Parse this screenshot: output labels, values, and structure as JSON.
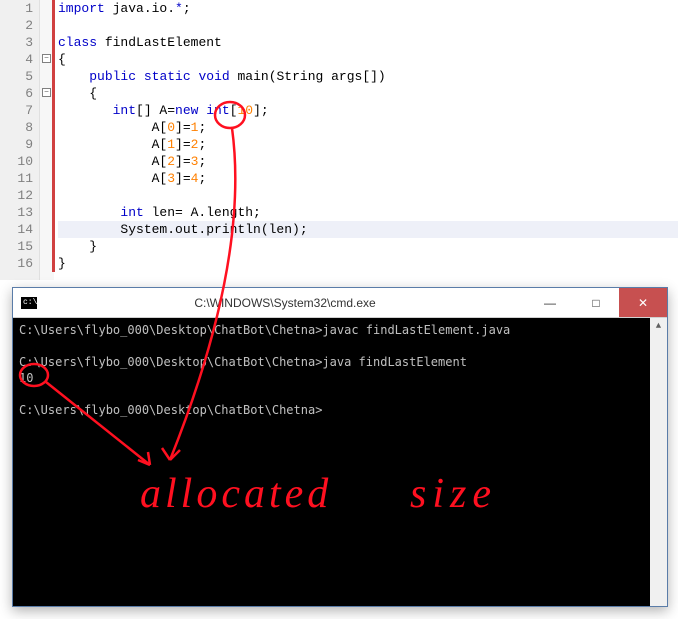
{
  "editor": {
    "lines": [
      {
        "n": 1,
        "indent": "",
        "tokens": [
          [
            "kw",
            "import"
          ],
          [
            " "
          ],
          [
            "pkg",
            "java.io."
          ],
          [
            "kw",
            "*"
          ],
          [
            ";"
          ]
        ]
      },
      {
        "n": 2,
        "indent": "",
        "tokens": []
      },
      {
        "n": 3,
        "indent": "",
        "tokens": [
          [
            "kw",
            "class"
          ],
          [
            " "
          ],
          [
            "id",
            "findLastElement"
          ]
        ]
      },
      {
        "n": 4,
        "indent": "",
        "tokens": [
          [
            "",
            "{"
          ]
        ]
      },
      {
        "n": 5,
        "indent": "    ",
        "tokens": [
          [
            "kw",
            "public"
          ],
          [
            " "
          ],
          [
            "kw",
            "static"
          ],
          [
            " "
          ],
          [
            "kw",
            "void"
          ],
          [
            " "
          ],
          [
            "id",
            "main(String args[])"
          ]
        ]
      },
      {
        "n": 6,
        "indent": "    ",
        "tokens": [
          [
            "",
            "{"
          ]
        ]
      },
      {
        "n": 7,
        "indent": "       ",
        "tokens": [
          [
            "kw",
            "int"
          ],
          [
            "",
            "[] A="
          ],
          [
            "kw",
            "new"
          ],
          [
            " "
          ],
          [
            "kw",
            "int"
          ],
          [
            "",
            "["
          ],
          [
            "num",
            "10"
          ],
          [
            "",
            "];"
          ]
        ]
      },
      {
        "n": 8,
        "indent": "            ",
        "tokens": [
          [
            "",
            "A["
          ],
          [
            "num",
            "0"
          ],
          [
            "",
            "]="
          ],
          [
            "num",
            "1"
          ],
          [
            "",
            ";"
          ]
        ]
      },
      {
        "n": 9,
        "indent": "            ",
        "tokens": [
          [
            "",
            "A["
          ],
          [
            "num",
            "1"
          ],
          [
            "",
            "]="
          ],
          [
            "num",
            "2"
          ],
          [
            "",
            ";"
          ]
        ]
      },
      {
        "n": 10,
        "indent": "            ",
        "tokens": [
          [
            "",
            "A["
          ],
          [
            "num",
            "2"
          ],
          [
            "",
            "]="
          ],
          [
            "num",
            "3"
          ],
          [
            "",
            ";"
          ]
        ]
      },
      {
        "n": 11,
        "indent": "            ",
        "tokens": [
          [
            "",
            "A["
          ],
          [
            "num",
            "3"
          ],
          [
            "",
            "]="
          ],
          [
            "num",
            "4"
          ],
          [
            "",
            ";"
          ]
        ]
      },
      {
        "n": 12,
        "indent": "",
        "tokens": []
      },
      {
        "n": 13,
        "indent": "        ",
        "tokens": [
          [
            "kw",
            "int"
          ],
          [
            "",
            " len= A.length;"
          ]
        ]
      },
      {
        "n": 14,
        "indent": "        ",
        "tokens": [
          [
            "",
            "System.out.println(len);"
          ]
        ],
        "hl": true
      },
      {
        "n": 15,
        "indent": "    ",
        "tokens": [
          [
            "",
            "}"
          ]
        ]
      },
      {
        "n": 16,
        "indent": "",
        "tokens": [
          [
            "",
            "}"
          ]
        ]
      }
    ]
  },
  "terminal": {
    "title": "C:\\WINDOWS\\System32\\cmd.exe",
    "lines": [
      "C:\\Users\\flybo_000\\Desktop\\ChatBot\\Chetna>javac findLastElement.java",
      "",
      "C:\\Users\\flybo_000\\Desktop\\ChatBot\\Chetna>java findLastElement",
      "10",
      "",
      "C:\\Users\\flybo_000\\Desktop\\ChatBot\\Chetna>"
    ]
  },
  "window": {
    "minimize": "—",
    "maximize": "□",
    "close": "✕"
  },
  "annotation": {
    "word1": "allocated",
    "word2": "size"
  }
}
